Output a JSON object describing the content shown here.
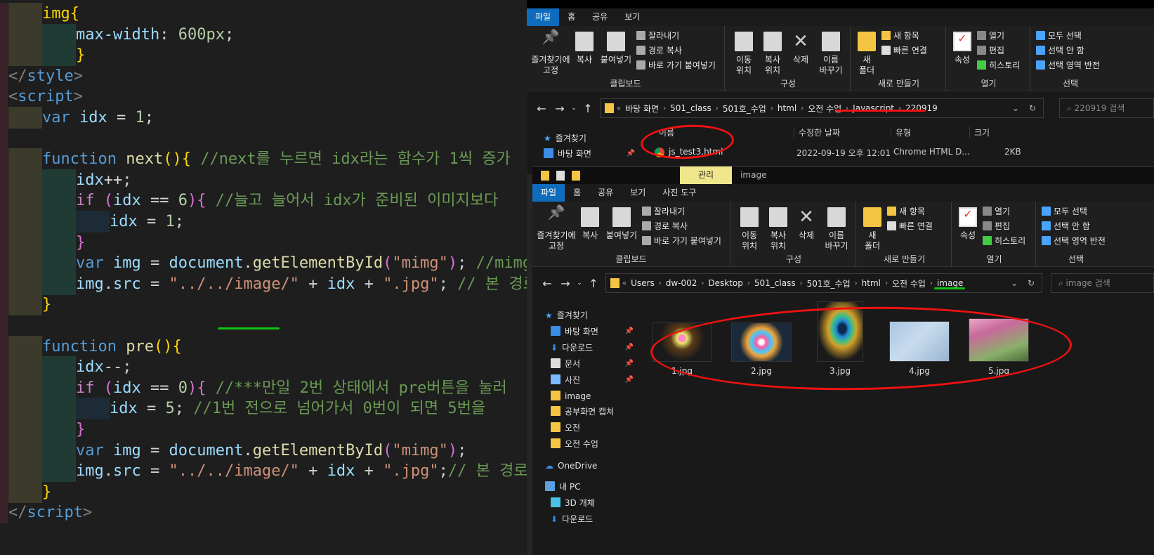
{
  "editor": {
    "lines": [
      {
        "segments": [
          {
            "t": "img",
            "c": "y"
          },
          {
            "t": "{",
            "c": "y"
          }
        ],
        "indent": 1,
        "guides": [
          "y"
        ]
      },
      {
        "segments": [
          {
            "t": "max-width",
            "c": "v"
          },
          {
            "t": ": ",
            "c": "p"
          },
          {
            "t": "600px",
            "c": "n"
          },
          {
            "t": ";",
            "c": "p"
          }
        ],
        "indent": 2,
        "guides": [
          "y",
          "g"
        ]
      },
      {
        "segments": [
          {
            "t": "}",
            "c": "y"
          }
        ],
        "indent": 2,
        "guides": [
          "y",
          "g"
        ]
      },
      {
        "segments": [
          {
            "t": "</",
            "c": "g2"
          },
          {
            "t": "style",
            "c": "k"
          },
          {
            "t": ">",
            "c": "g2"
          }
        ],
        "indent": 0,
        "guides": []
      },
      {
        "segments": [
          {
            "t": "<",
            "c": "g2"
          },
          {
            "t": "script",
            "c": "k"
          },
          {
            "t": ">",
            "c": "g2"
          }
        ],
        "indent": 0,
        "guides": []
      },
      {
        "segments": [
          {
            "t": "var ",
            "c": "k"
          },
          {
            "t": "idx",
            "c": "v"
          },
          {
            "t": " = ",
            "c": "p"
          },
          {
            "t": "1",
            "c": "n"
          },
          {
            "t": ";",
            "c": "p"
          }
        ],
        "indent": 1,
        "guides": [
          "y"
        ]
      },
      {
        "segments": [],
        "indent": 0,
        "guides": []
      },
      {
        "segments": [
          {
            "t": "function ",
            "c": "k"
          },
          {
            "t": "next",
            "c": "f"
          },
          {
            "t": "(){",
            "c": "y"
          },
          {
            "t": " //next를 누르면 idx라는 함수가 1씩 증가",
            "c": "c"
          }
        ],
        "indent": 1,
        "guides": [
          "y"
        ]
      },
      {
        "segments": [
          {
            "t": "idx",
            "c": "v"
          },
          {
            "t": "++;",
            "c": "p"
          }
        ],
        "indent": 2,
        "guides": [
          "y",
          "g"
        ]
      },
      {
        "segments": [
          {
            "t": "if ",
            "c": "kw"
          },
          {
            "t": "(",
            "c": "m"
          },
          {
            "t": "idx",
            "c": "v"
          },
          {
            "t": " == ",
            "c": "p"
          },
          {
            "t": "6",
            "c": "n"
          },
          {
            "t": ")",
            "c": "m"
          },
          {
            "t": "{",
            "c": "m"
          },
          {
            "t": " //늘고 늘어서 idx가 준비된 이미지보다",
            "c": "c"
          }
        ],
        "indent": 2,
        "guides": [
          "y",
          "g"
        ]
      },
      {
        "segments": [
          {
            "t": "idx",
            "c": "v"
          },
          {
            "t": " = ",
            "c": "p"
          },
          {
            "t": "1",
            "c": "n"
          },
          {
            "t": ";",
            "c": "p"
          }
        ],
        "indent": 3,
        "guides": [
          "y",
          "g",
          "b"
        ]
      },
      {
        "segments": [
          {
            "t": "}",
            "c": "m"
          }
        ],
        "indent": 2,
        "guides": [
          "y",
          "g"
        ]
      },
      {
        "segments": [
          {
            "t": "var ",
            "c": "k"
          },
          {
            "t": "img",
            "c": "v"
          },
          {
            "t": " = ",
            "c": "p"
          },
          {
            "t": "document",
            "c": "v"
          },
          {
            "t": ".",
            "c": "p"
          },
          {
            "t": "getElementById",
            "c": "f"
          },
          {
            "t": "(",
            "c": "m"
          },
          {
            "t": "\"mimg\"",
            "c": "s"
          },
          {
            "t": ")",
            "c": "m"
          },
          {
            "t": "; ",
            "c": "p"
          },
          {
            "t": "//mimg은",
            "c": "c"
          }
        ],
        "indent": 2,
        "guides": [
          "y",
          "g"
        ]
      },
      {
        "segments": [
          {
            "t": "img",
            "c": "v"
          },
          {
            "t": ".",
            "c": "p"
          },
          {
            "t": "src",
            "c": "v"
          },
          {
            "t": " = ",
            "c": "p"
          },
          {
            "t": "\"../../image/\"",
            "c": "s"
          },
          {
            "t": " + ",
            "c": "p"
          },
          {
            "t": "idx",
            "c": "v"
          },
          {
            "t": " + ",
            "c": "p"
          },
          {
            "t": "\".jpg\"",
            "c": "s"
          },
          {
            "t": "; ",
            "c": "p"
          },
          {
            "t": "// 본 경로",
            "c": "c"
          }
        ],
        "indent": 2,
        "guides": [
          "y",
          "g"
        ]
      },
      {
        "segments": [
          {
            "t": "}",
            "c": "y"
          }
        ],
        "indent": 1,
        "guides": [
          "y"
        ]
      },
      {
        "segments": [],
        "indent": 0,
        "guides": []
      },
      {
        "segments": [
          {
            "t": "function ",
            "c": "k"
          },
          {
            "t": "pre",
            "c": "f"
          },
          {
            "t": "(){",
            "c": "y"
          }
        ],
        "indent": 1,
        "guides": [
          "y"
        ]
      },
      {
        "segments": [
          {
            "t": "idx",
            "c": "v"
          },
          {
            "t": "--;",
            "c": "p"
          }
        ],
        "indent": 2,
        "guides": [
          "y",
          "g"
        ]
      },
      {
        "segments": [
          {
            "t": "if ",
            "c": "kw"
          },
          {
            "t": "(",
            "c": "m"
          },
          {
            "t": "idx",
            "c": "v"
          },
          {
            "t": " == ",
            "c": "p"
          },
          {
            "t": "0",
            "c": "n"
          },
          {
            "t": ")",
            "c": "m"
          },
          {
            "t": "{",
            "c": "m"
          },
          {
            "t": " //***만일 2번 상태에서 pre버튼을 눌러",
            "c": "c"
          }
        ],
        "indent": 2,
        "guides": [
          "y",
          "g"
        ]
      },
      {
        "segments": [
          {
            "t": "idx",
            "c": "v"
          },
          {
            "t": " = ",
            "c": "p"
          },
          {
            "t": "5",
            "c": "n"
          },
          {
            "t": "; ",
            "c": "p"
          },
          {
            "t": "//1번 전으로 넘어가서 0번이 되면 5번을",
            "c": "c"
          }
        ],
        "indent": 3,
        "guides": [
          "y",
          "g",
          "b"
        ]
      },
      {
        "segments": [
          {
            "t": "}",
            "c": "m"
          }
        ],
        "indent": 2,
        "guides": [
          "y",
          "g"
        ]
      },
      {
        "segments": [
          {
            "t": "var ",
            "c": "k"
          },
          {
            "t": "img",
            "c": "v"
          },
          {
            "t": " = ",
            "c": "p"
          },
          {
            "t": "document",
            "c": "v"
          },
          {
            "t": ".",
            "c": "p"
          },
          {
            "t": "getElementById",
            "c": "f"
          },
          {
            "t": "(",
            "c": "m"
          },
          {
            "t": "\"mimg\"",
            "c": "s"
          },
          {
            "t": ")",
            "c": "m"
          },
          {
            "t": ";",
            "c": "p"
          }
        ],
        "indent": 2,
        "guides": [
          "y",
          "g"
        ]
      },
      {
        "segments": [
          {
            "t": "img",
            "c": "v"
          },
          {
            "t": ".",
            "c": "p"
          },
          {
            "t": "src",
            "c": "v"
          },
          {
            "t": " = ",
            "c": "p"
          },
          {
            "t": "\"../../image/\"",
            "c": "s"
          },
          {
            "t": " + ",
            "c": "p"
          },
          {
            "t": "idx",
            "c": "v"
          },
          {
            "t": " + ",
            "c": "p"
          },
          {
            "t": "\".jpg\"",
            "c": "s"
          },
          {
            "t": ";",
            "c": "p"
          },
          {
            "t": "// 본 경로",
            "c": "c"
          }
        ],
        "indent": 2,
        "guides": [
          "y",
          "g"
        ]
      },
      {
        "segments": [
          {
            "t": "}",
            "c": "y"
          }
        ],
        "indent": 1,
        "guides": [
          "y"
        ]
      },
      {
        "segments": [
          {
            "t": "</",
            "c": "g2"
          },
          {
            "t": "script",
            "c": "k"
          },
          {
            "t": ">",
            "c": "g2"
          }
        ],
        "indent": 0,
        "guides": []
      }
    ]
  },
  "top_window": {
    "title": "220919",
    "tabs": [
      "파일",
      "홈",
      "공유",
      "보기"
    ],
    "ribbon": {
      "pin_label": "즐겨찾기에\n고정",
      "copy_label": "복사",
      "paste_label": "붙여넣기",
      "cut_label": "잘라내기",
      "copy_path_label": "경로 복사",
      "paste_shortcut_label": "바로 가기 붙여넣기",
      "clipboard_group": "클립보드",
      "move_label": "이동\n위치",
      "copyto_label": "복사\n위치",
      "delete_label": "삭제",
      "rename_label": "이름\n바꾸기",
      "organize_group": "구성",
      "new_folder_label": "새\n폴더",
      "new_item_label": "새 항목",
      "easy_access_label": "빠른 연결",
      "new_group": "새로 만들기",
      "properties_label": "속성",
      "open_label": "열기",
      "edit_label": "편집",
      "history_label": "히스토리",
      "open_group": "열기",
      "select_all_label": "모두 선택",
      "select_none_label": "선택 안 함",
      "invert_label": "선택 영역 반전",
      "select_group": "선택"
    },
    "path": [
      "바탕 화면",
      "501_class",
      "501호_수업",
      "html",
      "오전 수업",
      "Javascript",
      "220919"
    ],
    "search_placeholder": "220919 검색",
    "nav": [
      {
        "label": "즐겨찾기"
      },
      {
        "label": "바탕 화면"
      }
    ],
    "columns": [
      "이름",
      "수정한 날짜",
      "유형",
      "크기"
    ],
    "files": [
      {
        "name": "js_test3.html",
        "date": "2022-09-19 오후 12:01",
        "type": "Chrome HTML D...",
        "size": "2KB"
      }
    ]
  },
  "bottom_window": {
    "tabs": [
      "파일",
      "홈",
      "공유",
      "보기",
      "사진 도구"
    ],
    "context_tab": "관리",
    "title": "image",
    "path": [
      "Users",
      "dw-002",
      "Desktop",
      "501_class",
      "501호_수업",
      "html",
      "오전 수업",
      "image"
    ],
    "search_placeholder": "image 검색",
    "nav": [
      {
        "label": "즐겨찾기",
        "pinned": false
      },
      {
        "label": "바탕 화면",
        "pinned": true
      },
      {
        "label": "다운로드",
        "pinned": true
      },
      {
        "label": "문서",
        "pinned": true
      },
      {
        "label": "사진",
        "pinned": true
      },
      {
        "label": "image",
        "pinned": false
      },
      {
        "label": "공부화면 캡쳐",
        "pinned": false
      },
      {
        "label": "오전",
        "pinned": false
      },
      {
        "label": "오전 수업",
        "pinned": false
      },
      {
        "label": "OneDrive",
        "pinned": false
      },
      {
        "label": "내 PC",
        "pinned": false
      },
      {
        "label": "3D 개체",
        "pinned": false
      },
      {
        "label": "다운로드",
        "pinned": false
      }
    ],
    "thumbnails": [
      {
        "name": "1.jpg"
      },
      {
        "name": "2.jpg"
      },
      {
        "name": "3.jpg"
      },
      {
        "name": "4.jpg"
      },
      {
        "name": "5.jpg"
      }
    ]
  },
  "colors": {
    "accent": "#0f6cbd",
    "annotation_red": "#e11111",
    "annotation_green": "#13c213",
    "folder": "#f4c542"
  }
}
